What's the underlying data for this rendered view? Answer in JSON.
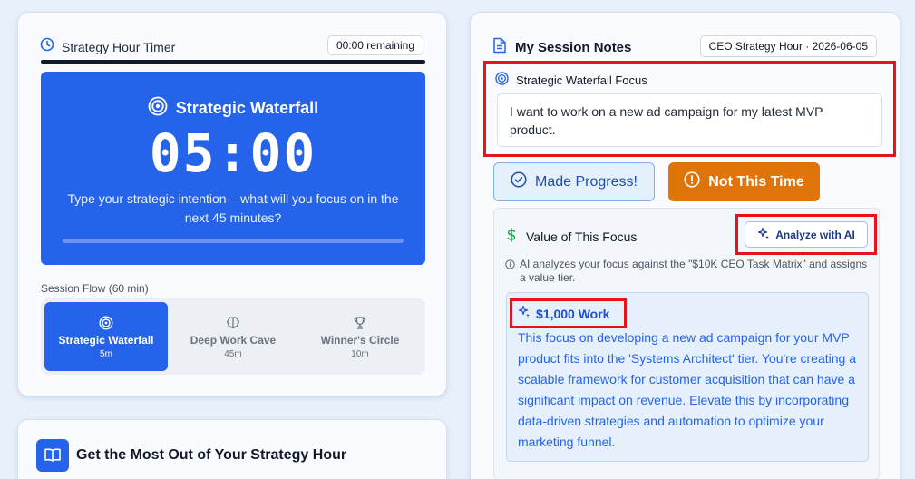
{
  "timer": {
    "title": "Strategy Hour Timer",
    "remaining": "00:00 remaining",
    "phase_title": "Strategic Waterfall",
    "clock": "05:00",
    "prompt": "Type your strategic intention – what will you focus on in the next 45 minutes?",
    "progress": 0,
    "flow_label": "Session Flow (60 min)",
    "steps": [
      {
        "name": "Strategic Waterfall",
        "duration": "5m",
        "icon": "target-icon",
        "active": true
      },
      {
        "name": "Deep Work Cave",
        "duration": "45m",
        "icon": "brain-icon",
        "active": false
      },
      {
        "name": "Winner's Circle",
        "duration": "10m",
        "icon": "trophy-icon",
        "active": false
      }
    ]
  },
  "tips": {
    "title": "Get the Most Out of Your Strategy Hour",
    "icon": "book-icon"
  },
  "notes": {
    "title": "My Session Notes",
    "date_badge": "CEO Strategy Hour · 2026-06-05",
    "focus_label": "Strategic Waterfall Focus",
    "focus_value": "I want to work on a new ad campaign for my latest MVP product.",
    "made_progress_label": "Made Progress!",
    "not_this_time_label": "Not This Time",
    "value_title": "Value of This Focus",
    "analyze_label": "Analyze with AI",
    "ai_note": "AI analyzes your focus against the \"$10K CEO Task Matrix\" and assigns a value tier.",
    "tier": "$1,000 Work",
    "result": "This focus on developing a new ad campaign for your MVP product fits into the 'Systems Architect' tier. You're creating a scalable framework for customer acquisition that can have a significant impact on revenue. Elevate this by incorporating data-driven strategies and automation to optimize your marketing funnel."
  },
  "colors": {
    "primary": "#2563eb",
    "warning": "#df7408",
    "highlight": "#e8131a",
    "background": "#e8f0fb"
  }
}
